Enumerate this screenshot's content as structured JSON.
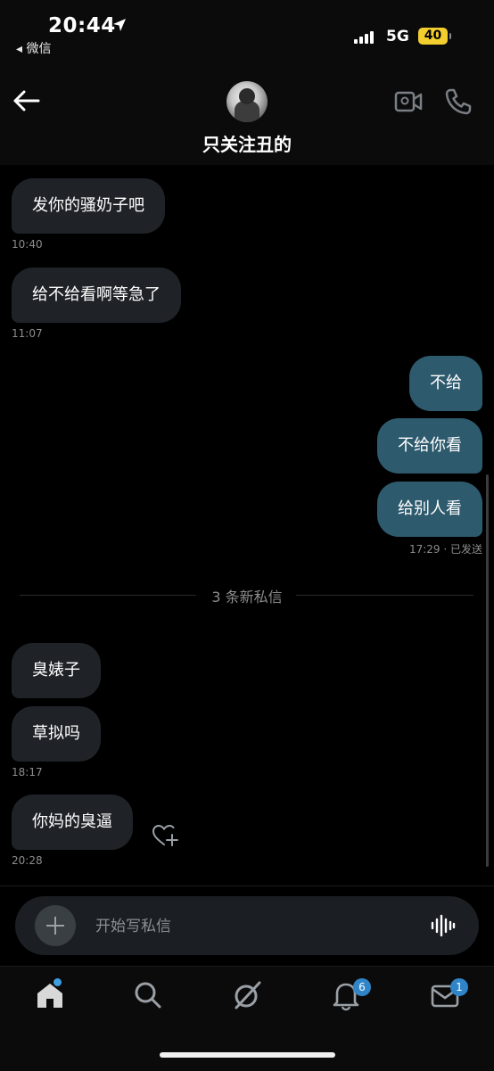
{
  "status_bar": {
    "time": "20:44",
    "back_app": "◂ 微信",
    "network": "5G",
    "battery": "40"
  },
  "header": {
    "contact_name": "只关注丑的",
    "back_icon": "arrow-left-icon",
    "video_icon": "video-call-icon",
    "phone_icon": "phone-icon"
  },
  "messages": [
    {
      "direction": "in",
      "text": "发你的骚奶子吧",
      "time": "10:40"
    },
    {
      "direction": "in",
      "text": "给不给看啊等急了",
      "time": "11:07"
    },
    {
      "direction": "out",
      "text": "不给"
    },
    {
      "direction": "out",
      "text": "不给你看"
    },
    {
      "direction": "out",
      "text": "给别人看",
      "status": "17:29 · 已发送"
    },
    {
      "direction": "in",
      "text": "臭婊子"
    },
    {
      "direction": "in",
      "text": "草拟吗",
      "time": "18:17"
    },
    {
      "direction": "in",
      "text": "你妈的臭逼",
      "time": "20:28"
    }
  ],
  "divider": {
    "text": "3 条新私信"
  },
  "composer": {
    "placeholder": "开始写私信"
  },
  "tab_bar": {
    "items": [
      {
        "icon": "home-icon"
      },
      {
        "icon": "search-icon"
      },
      {
        "icon": "grok-icon"
      },
      {
        "icon": "bell-icon",
        "badge": "6"
      },
      {
        "icon": "mail-icon",
        "badge": "1"
      }
    ]
  }
}
